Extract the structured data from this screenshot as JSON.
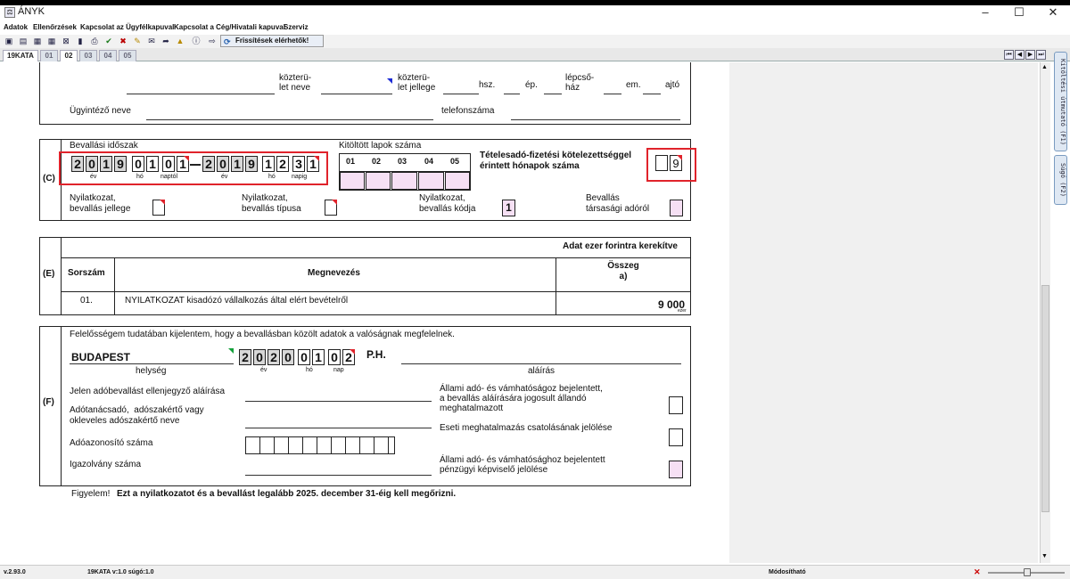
{
  "window": {
    "title": "ÁNYK"
  },
  "menu": [
    "Adatok",
    "Ellenőrzések",
    "Kapcsolat az Ügyfélkapuval",
    "Kapcsolat a Cég/Hivatali kapuval",
    "Szerviz"
  ],
  "toolbar": {
    "updates_label": "Frissítések elérhetők!"
  },
  "tabs": [
    "19KATA",
    "01",
    "02",
    "03",
    "04",
    "05"
  ],
  "side_tabs": [
    "Kitöltési útmutató (F1)",
    "Súgó (F2)"
  ],
  "address": {
    "street_type_label": "közterü-\nlet neve",
    "street_kind_label": "közterü-\nlet jellege",
    "hsz_label": "hsz.",
    "ep_label": "ép.",
    "lepcsohaz_label": "lépcső-\nház",
    "em_label": "em.",
    "ajto_label": "ajtó",
    "ugyintezo_label": "Ügyintéző neve",
    "telefon_label": "telefonszáma"
  },
  "section_c": {
    "letter": "(C)",
    "period_label": "Bevallási időszak",
    "from_digits": [
      "2",
      "0",
      "1",
      "9",
      "0",
      "1",
      "0",
      "1"
    ],
    "to_digits": [
      "2",
      "0",
      "1",
      "9",
      "1",
      "2",
      "3",
      "1"
    ],
    "sub_ev": "év",
    "sub_ho": "hó",
    "sub_naptol": "naptól",
    "sub_napig": "napig",
    "pages_label": "Kitöltött lapok száma",
    "page_cols": [
      "01",
      "02",
      "03",
      "04",
      "05"
    ],
    "months_label": "Tételesadó-fizetési kötelezettséggel\nérintett hónapok száma",
    "months_digits": [
      "",
      "9"
    ],
    "nyil_jellege": "Nyilatkozat,\nbevallás jellege",
    "nyil_tipusa": "Nyilatkozat,\nbevallás típusa",
    "nyil_kodja": "Nyilatkozat,\nbevallás kódja",
    "kod_value": "1",
    "tarsasagi": "Bevallás\ntársasági adóról"
  },
  "section_e": {
    "letter": "(E)",
    "note": "Adat ezer forintra kerekítve",
    "col_sorszam": "Sorszám",
    "col_megnevezes": "Megnevezés",
    "col_osszeg": "Összeg\na)",
    "row_num": "01.",
    "row_text": "NYILATKOZAT kisadózó vállalkozás által elért bevételről",
    "row_value": "9 000",
    "row_unit": "ezer"
  },
  "section_f": {
    "letter": "(F)",
    "declaration": "Felelősségem tudatában kijelentem, hogy a bevallásban közölt adatok a valóságnak megfelelnek.",
    "city": "BUDAPEST",
    "city_label": "helység",
    "date_digits": [
      "2",
      "0",
      "2",
      "0",
      "0",
      "1",
      "0",
      "2"
    ],
    "sub_ev": "év",
    "sub_ho": "hó",
    "sub_nap": "nap",
    "ph": "P.H.",
    "alairas": "aláírás",
    "ellenjegyzo": "Jelen adóbevallást ellenjegyző aláírása",
    "adotanacsado": "Adótanácsadó,  adószakértő vagy\nokleveles adószakértő neve",
    "adoazonosito": "Adóazonosító száma",
    "igazolvany": "Igazolvány száma",
    "allami1": "Állami adó- és vámhatóságoz bejelentett,\na bevallás aláírására jogosult állandó\nmeghatalmazott",
    "eseti": "Eseti meghatalmazás csatolásának jelölése",
    "allami2": "Állami adó- és vámhatósághoz bejelentett\npénzügyi képviselő jelölése"
  },
  "footer": {
    "figyelem": "Figyelem!",
    "warning": "Ezt a nyilatkozatot és a bevallást legalább 2025. december 31-éig kell megőrizni."
  },
  "status": {
    "version": "v.2.93.0",
    "form_info": "19KATA v:1.0 súgó:1.0",
    "mode": "Módosítható"
  }
}
